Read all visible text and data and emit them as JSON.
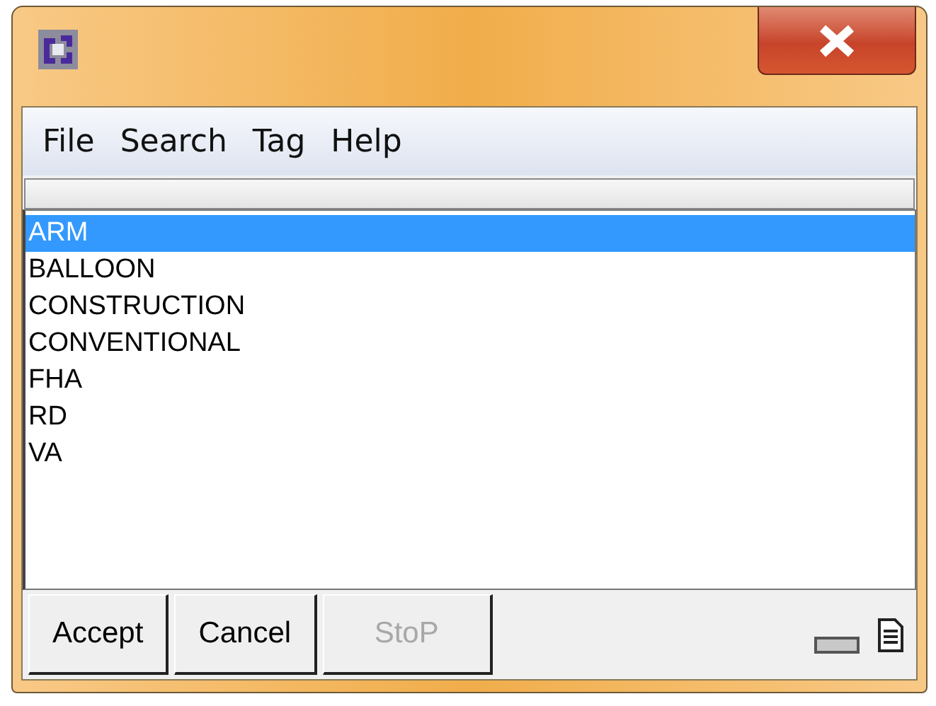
{
  "menu": [
    {
      "label": "File"
    },
    {
      "label": "Search"
    },
    {
      "label": "Tag"
    },
    {
      "label": "Help"
    }
  ],
  "list": {
    "items": [
      {
        "label": "ARM",
        "selected": true
      },
      {
        "label": "BALLOON",
        "selected": false
      },
      {
        "label": "CONSTRUCTION",
        "selected": false
      },
      {
        "label": "CONVENTIONAL",
        "selected": false
      },
      {
        "label": "FHA",
        "selected": false
      },
      {
        "label": "RD",
        "selected": false
      },
      {
        "label": "VA",
        "selected": false
      }
    ]
  },
  "buttons": [
    {
      "label": "Accept",
      "disabled": false
    },
    {
      "label": "Cancel",
      "disabled": false
    },
    {
      "label": "StoP",
      "disabled": true
    }
  ]
}
